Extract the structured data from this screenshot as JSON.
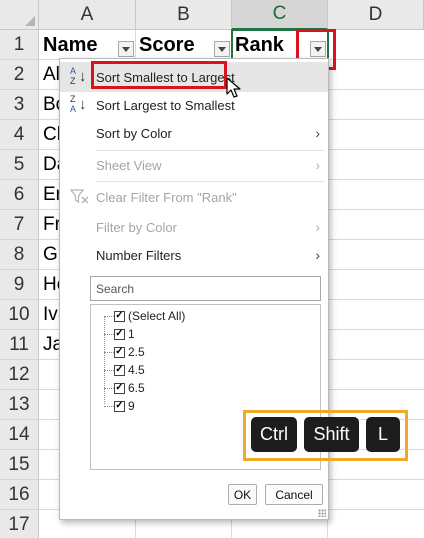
{
  "sheet": {
    "columns": [
      "A",
      "B",
      "C",
      "D"
    ],
    "rows": [
      "1",
      "2",
      "3",
      "4",
      "5",
      "6",
      "7",
      "8",
      "9",
      "10",
      "11",
      "12",
      "13",
      "14",
      "15",
      "16",
      "17"
    ],
    "header_row": {
      "name": "Name",
      "score": "Score",
      "rank": "Rank"
    },
    "name_cells": [
      "Al",
      "Bo",
      "Ch",
      "Da",
      "Er",
      "Fr",
      "Gr",
      "He",
      "Iv",
      "Ja"
    ]
  },
  "filter_menu": {
    "items": [
      {
        "icon_top": "A",
        "icon_bottom": "Z",
        "label": "Sort Smallest to Largest",
        "enabled": true,
        "highlighted": true
      },
      {
        "icon_top": "Z",
        "icon_bottom": "A",
        "label": "Sort Largest to Smallest",
        "enabled": true
      },
      {
        "label": "Sort by Color",
        "enabled": true,
        "submenu": true
      },
      {
        "label": "Sheet View",
        "enabled": false,
        "submenu": true
      },
      {
        "label": "Clear Filter From \"Rank\"",
        "enabled": false
      },
      {
        "label": "Filter by Color",
        "enabled": false,
        "submenu": true
      },
      {
        "label": "Number Filters",
        "enabled": true,
        "submenu": true
      }
    ],
    "submenu_glyph": "›",
    "search_placeholder": "Search",
    "values": [
      {
        "label": "(Select All)",
        "checked": true
      },
      {
        "label": "1",
        "checked": true
      },
      {
        "label": "2.5",
        "checked": true
      },
      {
        "label": "4.5",
        "checked": true
      },
      {
        "label": "6.5",
        "checked": true
      },
      {
        "label": "9",
        "checked": true
      }
    ],
    "check_glyph": "✓",
    "ok_label": "OK",
    "cancel_label": "Cancel"
  },
  "shortcut": {
    "keys": [
      "Ctrl",
      "Shift",
      "L"
    ]
  },
  "colors": {
    "highlight_red": "#d9141f",
    "highlight_gold": "#f0a82a",
    "excel_green": "#217346",
    "key_bg": "#1d1d1d"
  },
  "icons": {
    "filter_dropdown": "filter-dropdown-icon",
    "sort_ascending": "sort-ascending-icon",
    "sort_descending": "sort-descending-icon",
    "clear_filter": "clear-filter-icon",
    "chevron_right": "chevron-right-icon",
    "mouse_pointer": "mouse-pointer-icon",
    "resize_grip": "resize-grip-icon"
  }
}
